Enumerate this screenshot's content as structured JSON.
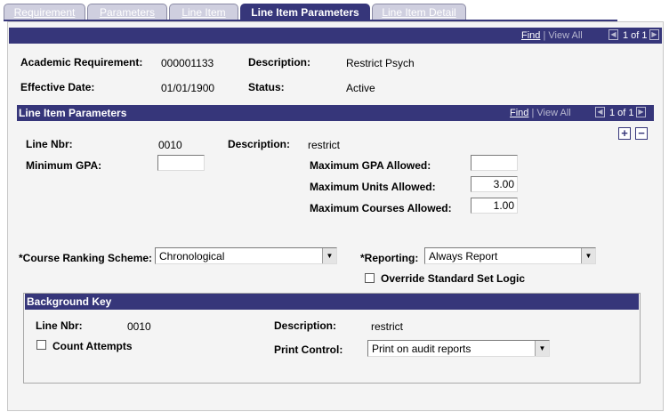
{
  "tabs": [
    {
      "label": "Requirement",
      "active": false
    },
    {
      "label": "Parameters",
      "active": false
    },
    {
      "label": "Line Item",
      "active": false
    },
    {
      "label": "Line Item Parameters",
      "active": true
    },
    {
      "label": "Line Item Detail",
      "active": false
    }
  ],
  "top_nav": {
    "find": "Find",
    "sep": "|",
    "view_all": "View All",
    "counter": "1 of 1"
  },
  "header": {
    "academic_requirement_label": "Academic Requirement:",
    "academic_requirement_value": "000001133",
    "description_label": "Description:",
    "description_value": "Restrict Psych",
    "effective_date_label": "Effective Date:",
    "effective_date_value": "01/01/1900",
    "status_label": "Status:",
    "status_value": "Active"
  },
  "line_item_parameters": {
    "title": "Line Item Parameters",
    "nav": {
      "find": "Find",
      "sep": "|",
      "view_all": "View All",
      "counter": "1 of 1"
    },
    "add_label": "+",
    "remove_label": "−",
    "line_nbr_label": "Line Nbr:",
    "line_nbr_value": "0010",
    "description_label": "Description:",
    "description_value": "restrict",
    "minimum_gpa_label": "Minimum GPA:",
    "minimum_gpa_value": "",
    "max_gpa_label": "Maximum GPA Allowed:",
    "max_gpa_value": "",
    "max_units_label": "Maximum Units Allowed:",
    "max_units_value": "3.00",
    "max_courses_label": "Maximum Courses Allowed:",
    "max_courses_value": "1.00",
    "ranking_label": "*Course Ranking Scheme:",
    "ranking_value": "Chronological",
    "reporting_label": "*Reporting:",
    "reporting_value": "Always Report",
    "override_label": "Override Standard Set Logic"
  },
  "background_key": {
    "title": "Background Key",
    "line_nbr_label": "Line Nbr:",
    "line_nbr_value": "0010",
    "description_label": "Description:",
    "description_value": "restrict",
    "count_attempts_label": "Count Attempts",
    "print_control_label": "Print Control:",
    "print_control_value": "Print on audit reports"
  },
  "icons": {
    "first": "▏◀",
    "prev": "◀",
    "dropdown": "▼"
  }
}
